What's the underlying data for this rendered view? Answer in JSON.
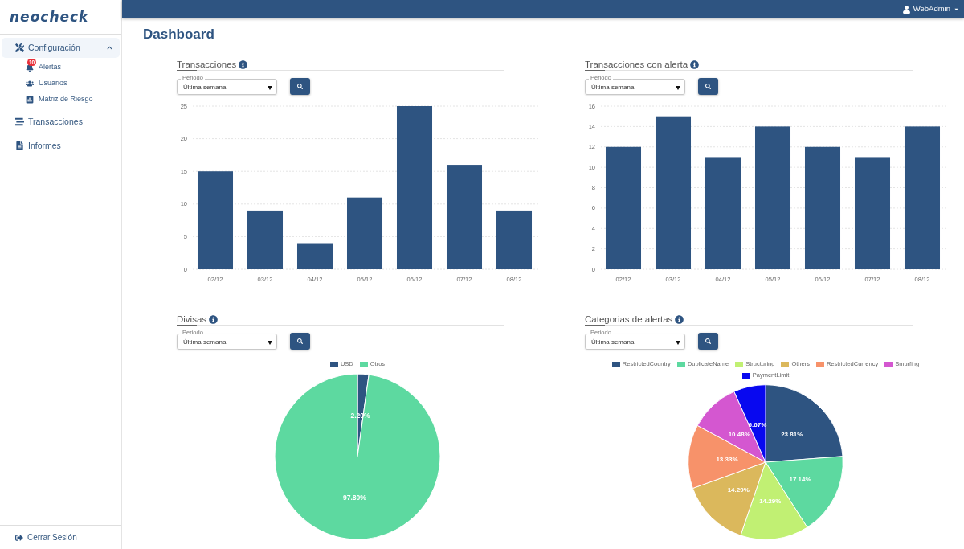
{
  "sidebar": {
    "logo": "neocheck",
    "items": [
      {
        "label": "Configuración",
        "selected": true,
        "expanded": true,
        "children": [
          {
            "label": "Alertas",
            "selected": false,
            "badge": "10"
          },
          {
            "label": "Usuarios",
            "selected": false
          },
          {
            "label": "Matriz de Riesgo",
            "selected": false
          }
        ]
      },
      {
        "label": "Transacciones",
        "selected": false
      },
      {
        "label": "Informes",
        "selected": false
      }
    ],
    "logout": "Cerrar Sesión"
  },
  "header": {
    "user": "WebAdmin"
  },
  "page_title": "Dashboard",
  "panels": [
    {
      "title": "Transacciones",
      "filter": {
        "label": "Periodo",
        "value": "Última semana"
      },
      "chart_data": {
        "type": "bar",
        "categories": [
          "02/12",
          "03/12",
          "04/12",
          "05/12",
          "06/12",
          "07/12",
          "08/12"
        ],
        "values": [
          15,
          9,
          4,
          11,
          25,
          16,
          9
        ],
        "ylim": [
          0,
          25
        ],
        "yticks": [
          0,
          5,
          10,
          15,
          20,
          25
        ],
        "grid": true
      }
    },
    {
      "title": "Transacciones con alerta",
      "filter": {
        "label": "Periodo",
        "value": "Última semana"
      },
      "chart_data": {
        "type": "bar",
        "categories": [
          "02/12",
          "03/12",
          "04/12",
          "05/12",
          "06/12",
          "07/12",
          "08/12"
        ],
        "values": [
          12,
          15,
          11,
          14,
          12,
          11,
          14
        ],
        "ylim": [
          0,
          16
        ],
        "yticks": [
          0,
          2,
          4,
          6,
          8,
          10,
          12,
          14,
          16
        ],
        "grid": true
      }
    },
    {
      "title": "Divisas",
      "filter": {
        "label": "Periodo",
        "value": "Última semana"
      },
      "chart_data": {
        "type": "pie",
        "categories": [
          "USD",
          "Otros"
        ],
        "values": [
          2.2,
          97.8
        ],
        "colors": [
          "#2e5481",
          "#5dd9a0"
        ],
        "legend": "top",
        "data_labels": true,
        "value_labels": [
          "2.20%",
          "97.80%"
        ]
      }
    },
    {
      "title": "Categorias de alertas",
      "filter": {
        "label": "Periodo",
        "value": "Última semana"
      },
      "chart_data": {
        "type": "pie",
        "categories": [
          "RestrictedCountry",
          "DuplicateName",
          "Structuring",
          "Others",
          "RestrictedCurrency",
          "Smurfing",
          "PaymentLimit"
        ],
        "values": [
          23.81,
          17.14,
          14.29,
          14.29,
          13.33,
          10.48,
          6.67
        ],
        "colors": [
          "#2e5481",
          "#5dd9a0",
          "#c1f073",
          "#dbb85c",
          "#f7926a",
          "#d457d0",
          "#0808f0"
        ],
        "legend": "top",
        "data_labels": true,
        "value_labels": [
          "23.81%",
          "17.14%",
          "14.29%",
          "14.29%",
          "13.33%",
          "10.48%",
          "6.67%"
        ]
      }
    }
  ]
}
